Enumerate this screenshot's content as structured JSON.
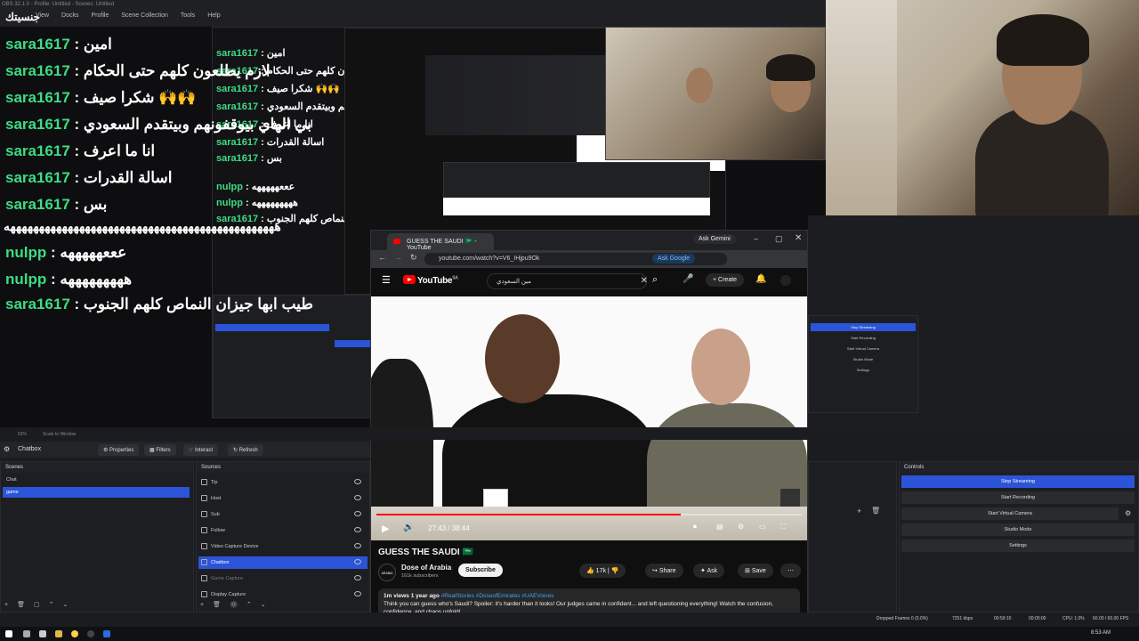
{
  "obs": {
    "title": "OBS 32.1.0 - Profile: Untitled - Scenes: Untitled",
    "logo_text": "جنسيتك",
    "menu": [
      "View",
      "Docks",
      "Profile",
      "Scene Collection",
      "Tools",
      "Help"
    ],
    "chat_lines": [
      {
        "user": "sara1617",
        "msg": "امين"
      },
      {
        "user": "sara1617",
        "msg": "لازم يطلعون كلهم حتى الحكام"
      },
      {
        "user": "sara1617",
        "msg": "شكرا صيف 🙌🙌"
      },
      {
        "user": "sara1617",
        "msg": "بي الهاي بيوقفونهم وبيتقدم السعودي"
      },
      {
        "user": "sara1617",
        "msg": "انا ما اعرف"
      },
      {
        "user": "sara1617",
        "msg": "اسالة القدرات"
      },
      {
        "user": "sara1617",
        "msg": "بس"
      }
    ],
    "spam_line": "هههههههههههههههههههههههههههههههههههههههههههههههه",
    "nulpp_lines": [
      {
        "user": "nulpp",
        "msg": "عععهههههه"
      },
      {
        "user": "nulpp",
        "msg": "هههههههههه"
      }
    ],
    "last_chat": {
      "user": "sara1617",
      "msg": "طيب ابها جيزان النماص كلهم الجنوب"
    },
    "zoom_label": "62%",
    "scale_label": "Scale to Window",
    "selected_source": "Chatbox",
    "source_toolbar": {
      "properties": "Properties",
      "filters": "Filters",
      "interact": "Interact",
      "refresh": "Refresh"
    },
    "scenes_title": "Scenes",
    "scenes": [
      "Chat",
      "game"
    ],
    "selected_scene": "game",
    "sources_title": "Sources",
    "sources": [
      "Tip",
      "Host",
      "Sub",
      "Follow",
      "Video Capture Device",
      "Chatbox",
      "Game Capture",
      "Display Capture"
    ],
    "controls_title": "Controls",
    "controls": [
      "Stop Streaming",
      "Start Recording",
      "Start Virtual Camera",
      "Studio Mode",
      "Settings"
    ],
    "mini_controls": [
      "Stop Streaming",
      "Start Recording",
      "Start Virtual Camera",
      "Studio Mode",
      "Settings"
    ],
    "status": {
      "dropped": "Dropped Frames 0 (0.0%)",
      "bitrate": "7251 kbps",
      "time": "00:59:10",
      "rec": "00:00:00",
      "cpu": "CPU: 1.0%",
      "fps": "60.00 / 60.00 FPS"
    }
  },
  "browser": {
    "tab_title": "GUESS THE SAUDI 🇸🇦 - YouTube",
    "url": "youtube.com/watch?v=V6_IHjpu9Ok",
    "ask_google": "Ask Google",
    "ask_gemini": "Ask Gemini",
    "yt_logo": "YouTube",
    "yt_region": "SA",
    "search_value": "مين السعودي",
    "create_label": "Create",
    "video_time": "27:43 / 38:44",
    "progress_fraction": 0.716,
    "video_title": "GUESS THE SAUDI 🇸🇦",
    "channel_name": "Dose of Arabia",
    "subscribers": "161k subscribers",
    "channel_avatar_text": "ARABIA",
    "subscribe_label": "Subscribe",
    "like_count": "17k",
    "share_label": "Share",
    "ask_label": "Ask",
    "save_label": "Save",
    "views_line": "1m views  1 year ago",
    "tags": "#RealStories #DoseofEmirates #UAEVoices",
    "description": "Think you can guess who's Saudi? Spoiler: it's harder than it looks! Our judges came in confident... and left questioning everything! Watch the confusion, confidence, and chaos unfold!"
  },
  "taskbar": {
    "clock": "8:53 AM"
  },
  "colors": {
    "accent": "#2c54d8",
    "chat_user": "#3ddc84",
    "yt_red": "#ff0000"
  }
}
